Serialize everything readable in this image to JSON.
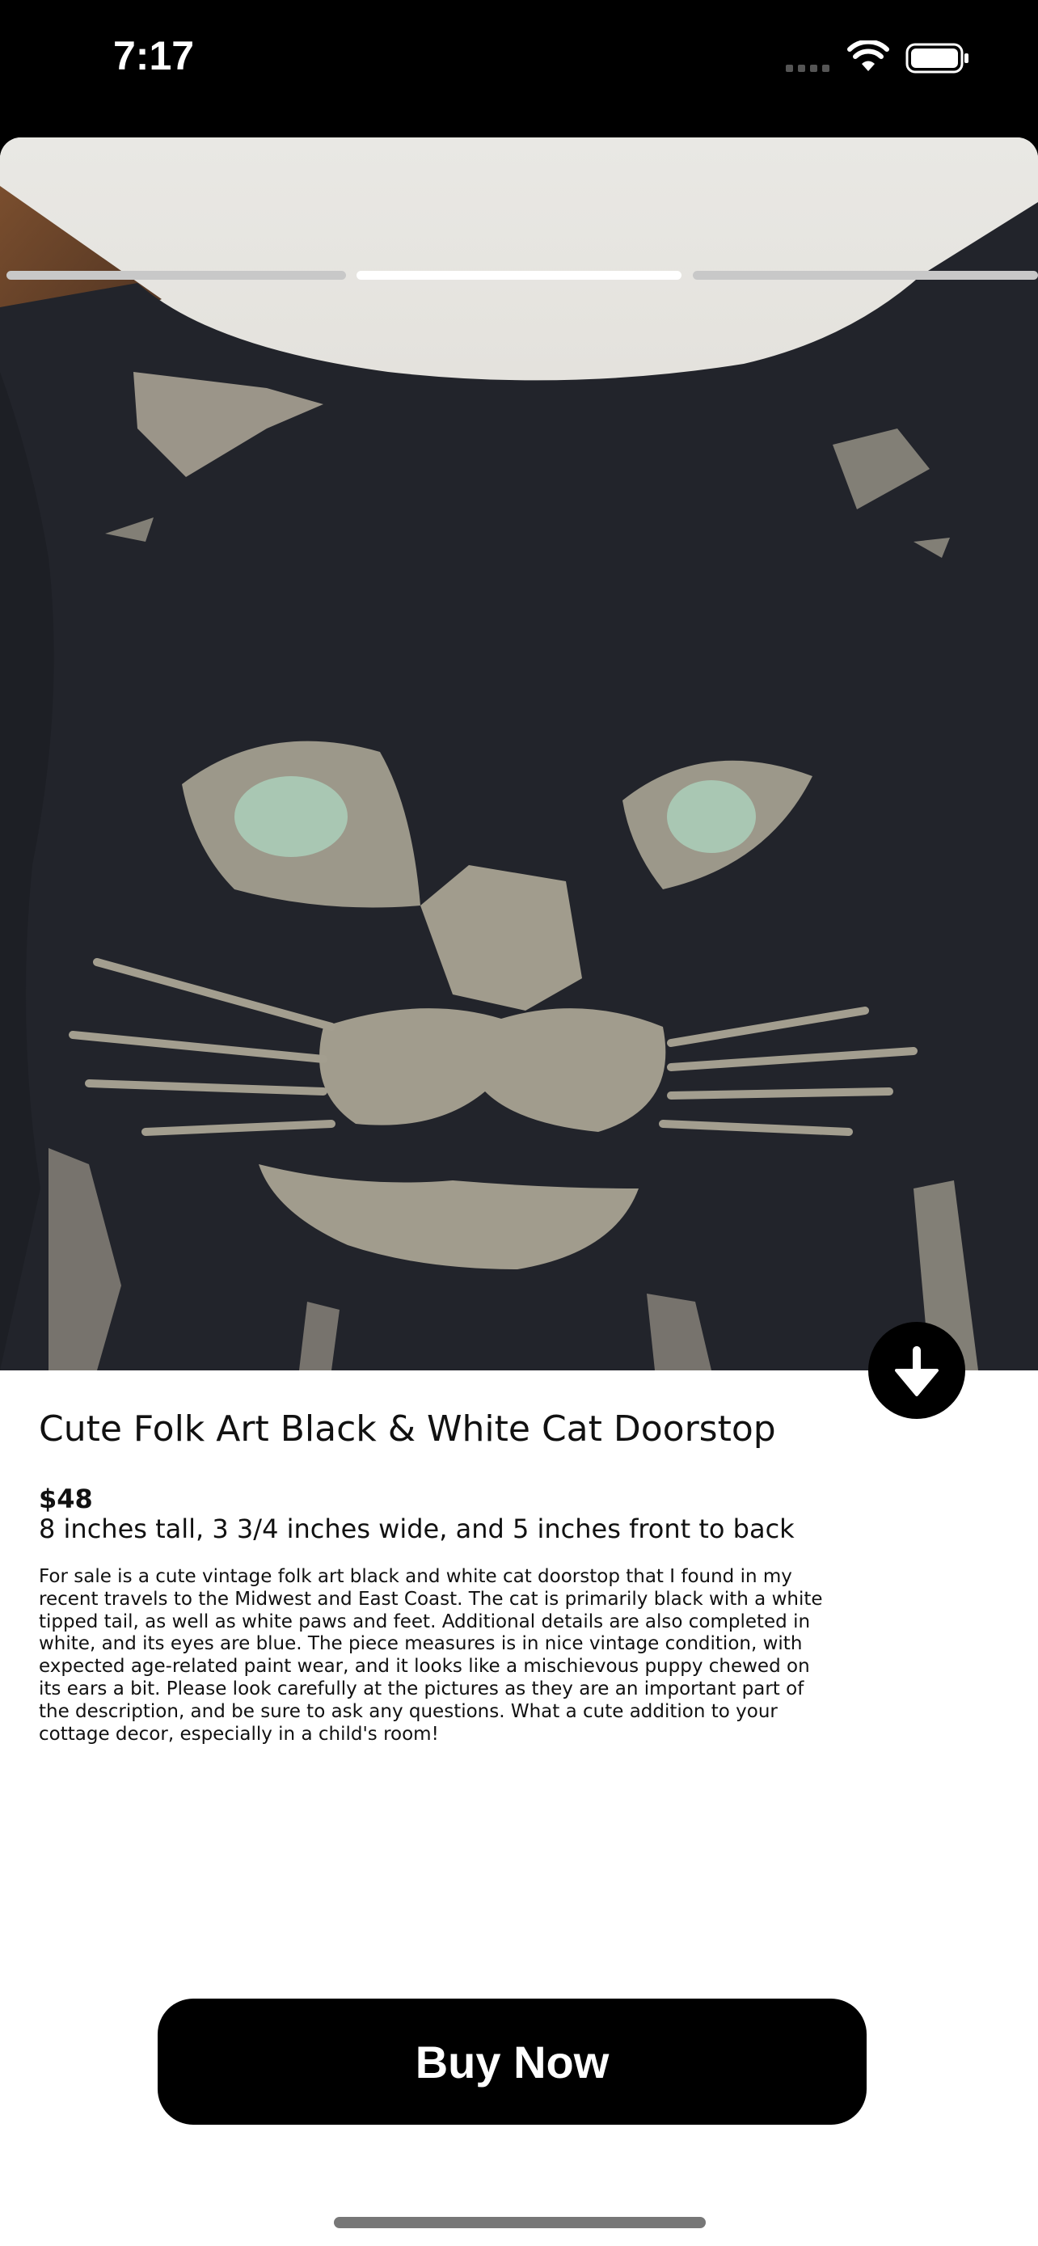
{
  "status_bar": {
    "time": "7:17",
    "icons": [
      "signal-icon",
      "wifi-icon",
      "battery-icon"
    ]
  },
  "gallery": {
    "image_subject": "black cat doorstop photo",
    "page_count": 3,
    "active_page": 2,
    "scroll_button_icon": "arrow-down-icon"
  },
  "product": {
    "title": "Cute Folk Art Black & White Cat Doorstop",
    "price": "$48",
    "dimensions": "8 inches tall, 3 3/4 inches wide, and 5 inches front to back",
    "description": "For sale is a cute vintage folk art black and white cat doorstop that I found in my recent travels to the Midwest and East Coast. The cat is primarily black with a white tipped tail, as well as white paws and feet. Additional details are also completed in white, and its eyes are blue. The piece measures is in nice vintage condition, with expected age-related paint wear, and it looks like a mischievous puppy chewed on its ears a bit. Please look carefully at the pictures as they are an important part of the description, and be sure to ask any questions. What a cute addition to your cottage decor, especially in a child's room!"
  },
  "actions": {
    "buy_label": "Buy Now"
  },
  "colors": {
    "button_bg": "#000000",
    "button_text": "#ffffff",
    "progress_active": "#ffffff",
    "progress_inactive": "#c8c8c8"
  }
}
